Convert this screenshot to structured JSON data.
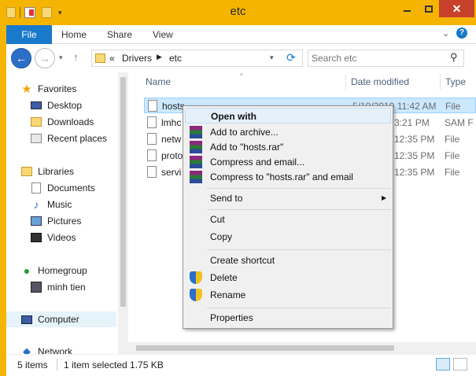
{
  "window": {
    "title": "etc"
  },
  "ribbon": {
    "tabs": [
      "File",
      "Home",
      "Share",
      "View"
    ]
  },
  "address": {
    "overflow": "«",
    "crumbs": [
      "Drivers",
      "etc"
    ]
  },
  "search": {
    "placeholder": "Search etc"
  },
  "nav": {
    "favorites": {
      "label": "Favorites",
      "items": [
        "Desktop",
        "Downloads",
        "Recent places"
      ]
    },
    "libraries": {
      "label": "Libraries",
      "items": [
        "Documents",
        "Music",
        "Pictures",
        "Videos"
      ]
    },
    "homegroup": {
      "label": "Homegroup",
      "items": [
        "minh tien"
      ]
    },
    "computer": {
      "label": "Computer"
    },
    "network": {
      "label": "Network"
    }
  },
  "columns": {
    "name": "Name",
    "date": "Date modified",
    "type": "Type"
  },
  "files": [
    {
      "name": "hosts",
      "date": "5/10/2019 11:42 AM",
      "type": "File"
    },
    {
      "name": "lmhc",
      "date": "3:21 PM",
      "type": "SAM F"
    },
    {
      "name": "netw",
      "date": "12:35 PM",
      "type": "File"
    },
    {
      "name": "proto",
      "date": "12:35 PM",
      "type": "File"
    },
    {
      "name": "servi",
      "date": "12:35 PM",
      "type": "File"
    }
  ],
  "status": {
    "items": "5 items",
    "selected": "1 item selected 1.75 KB"
  },
  "context_menu": {
    "open_with": "Open with",
    "add_archive": "Add to archive...",
    "add_hosts_rar": "Add to \"hosts.rar\"",
    "compress_email": "Compress and email...",
    "compress_hosts_email": "Compress to \"hosts.rar\" and email",
    "send_to": "Send to",
    "cut": "Cut",
    "copy": "Copy",
    "create_shortcut": "Create shortcut",
    "delete": "Delete",
    "rename": "Rename",
    "properties": "Properties"
  },
  "colors": {
    "accent": "#1979ca",
    "frame": "#f5b400",
    "close": "#c7402a",
    "selection": "#cce8ff"
  }
}
